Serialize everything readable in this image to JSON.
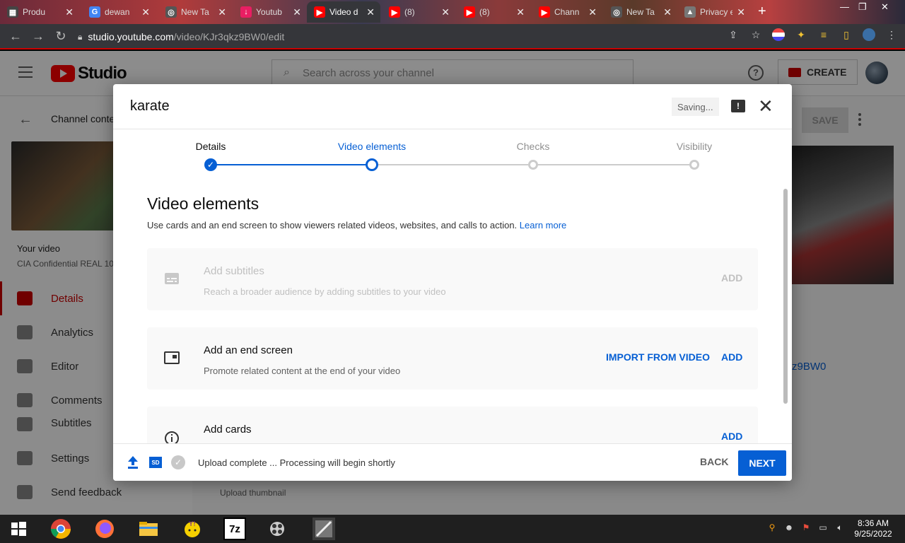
{
  "browser": {
    "tabs": [
      {
        "title": "Produ",
        "color": "#444444",
        "glyph": "▦"
      },
      {
        "title": "dewan",
        "color": "#4285f4",
        "glyph": "G"
      },
      {
        "title": "New Ta",
        "color": "#555555",
        "glyph": "◎"
      },
      {
        "title": "Youtub",
        "color": "#e91e63",
        "glyph": "↓"
      },
      {
        "title": "Video d",
        "color": "#ff0000",
        "glyph": "▶",
        "active": true
      },
      {
        "title": "(8)",
        "color": "#ff0000",
        "glyph": "▶"
      },
      {
        "title": "(8)",
        "color": "#ff0000",
        "glyph": "▶"
      },
      {
        "title": "Chann",
        "color": "#ff0000",
        "glyph": "▶"
      },
      {
        "title": "New Ta",
        "color": "#555555",
        "glyph": "◎"
      },
      {
        "title": "Privacy error",
        "color": "#777777",
        "glyph": "▲"
      }
    ],
    "url_host": "studio.youtube.com",
    "url_path": "/video/KJr3qkz9BW0/edit"
  },
  "studio": {
    "logo_text": "Studio",
    "search_placeholder": "Search across your channel",
    "help_glyph": "?",
    "create_label": "CREATE",
    "channel_content": "Channel content",
    "your_video": "Your video",
    "video_title": "CIA Confidential REAL 10",
    "nav": [
      {
        "label": "Details",
        "active": true
      },
      {
        "label": "Analytics"
      },
      {
        "label": "Editor"
      },
      {
        "label": "Comments"
      },
      {
        "label": "Subtitles"
      },
      {
        "label": "Settings"
      },
      {
        "label": "Send feedback"
      }
    ],
    "save_label": "SAVE",
    "video_id_fragment": "z9BW0",
    "upload_thumbnail": "Upload thumbnail"
  },
  "dialog": {
    "title": "karate",
    "saving": "Saving...",
    "feedback_glyph": "!",
    "close_glyph": "✕",
    "steps": [
      {
        "label": "Details",
        "state": "done"
      },
      {
        "label": "Video elements",
        "state": "current"
      },
      {
        "label": "Checks",
        "state": "future"
      },
      {
        "label": "Visibility",
        "state": "future"
      }
    ],
    "section_title": "Video elements",
    "section_desc": "Use cards and an end screen to show viewers related videos, websites, and calls to action.",
    "learn_more": "Learn more",
    "elements": [
      {
        "title": "Add subtitles",
        "desc": "Reach a broader audience by adding subtitles to your video",
        "action": "ADD",
        "disabled": true,
        "icon": "subtitles-icon"
      },
      {
        "title": "Add an end screen",
        "desc": "Promote related content at the end of your video",
        "secondary_action": "IMPORT FROM VIDEO",
        "action": "ADD",
        "icon": "end-screen-icon"
      },
      {
        "title": "Add cards",
        "desc": "",
        "action": "ADD",
        "icon": "info-icon"
      }
    ],
    "footer": {
      "hd_badge": "SD",
      "status": "Upload complete ... Processing will begin shortly",
      "back_label": "BACK",
      "next_label": "NEXT"
    }
  },
  "taskbar": {
    "time": "8:36 AM",
    "date": "9/25/2022",
    "zip_label": "7z"
  },
  "colors": {
    "accent": "#065fd4",
    "brand_red": "#ff0000"
  }
}
